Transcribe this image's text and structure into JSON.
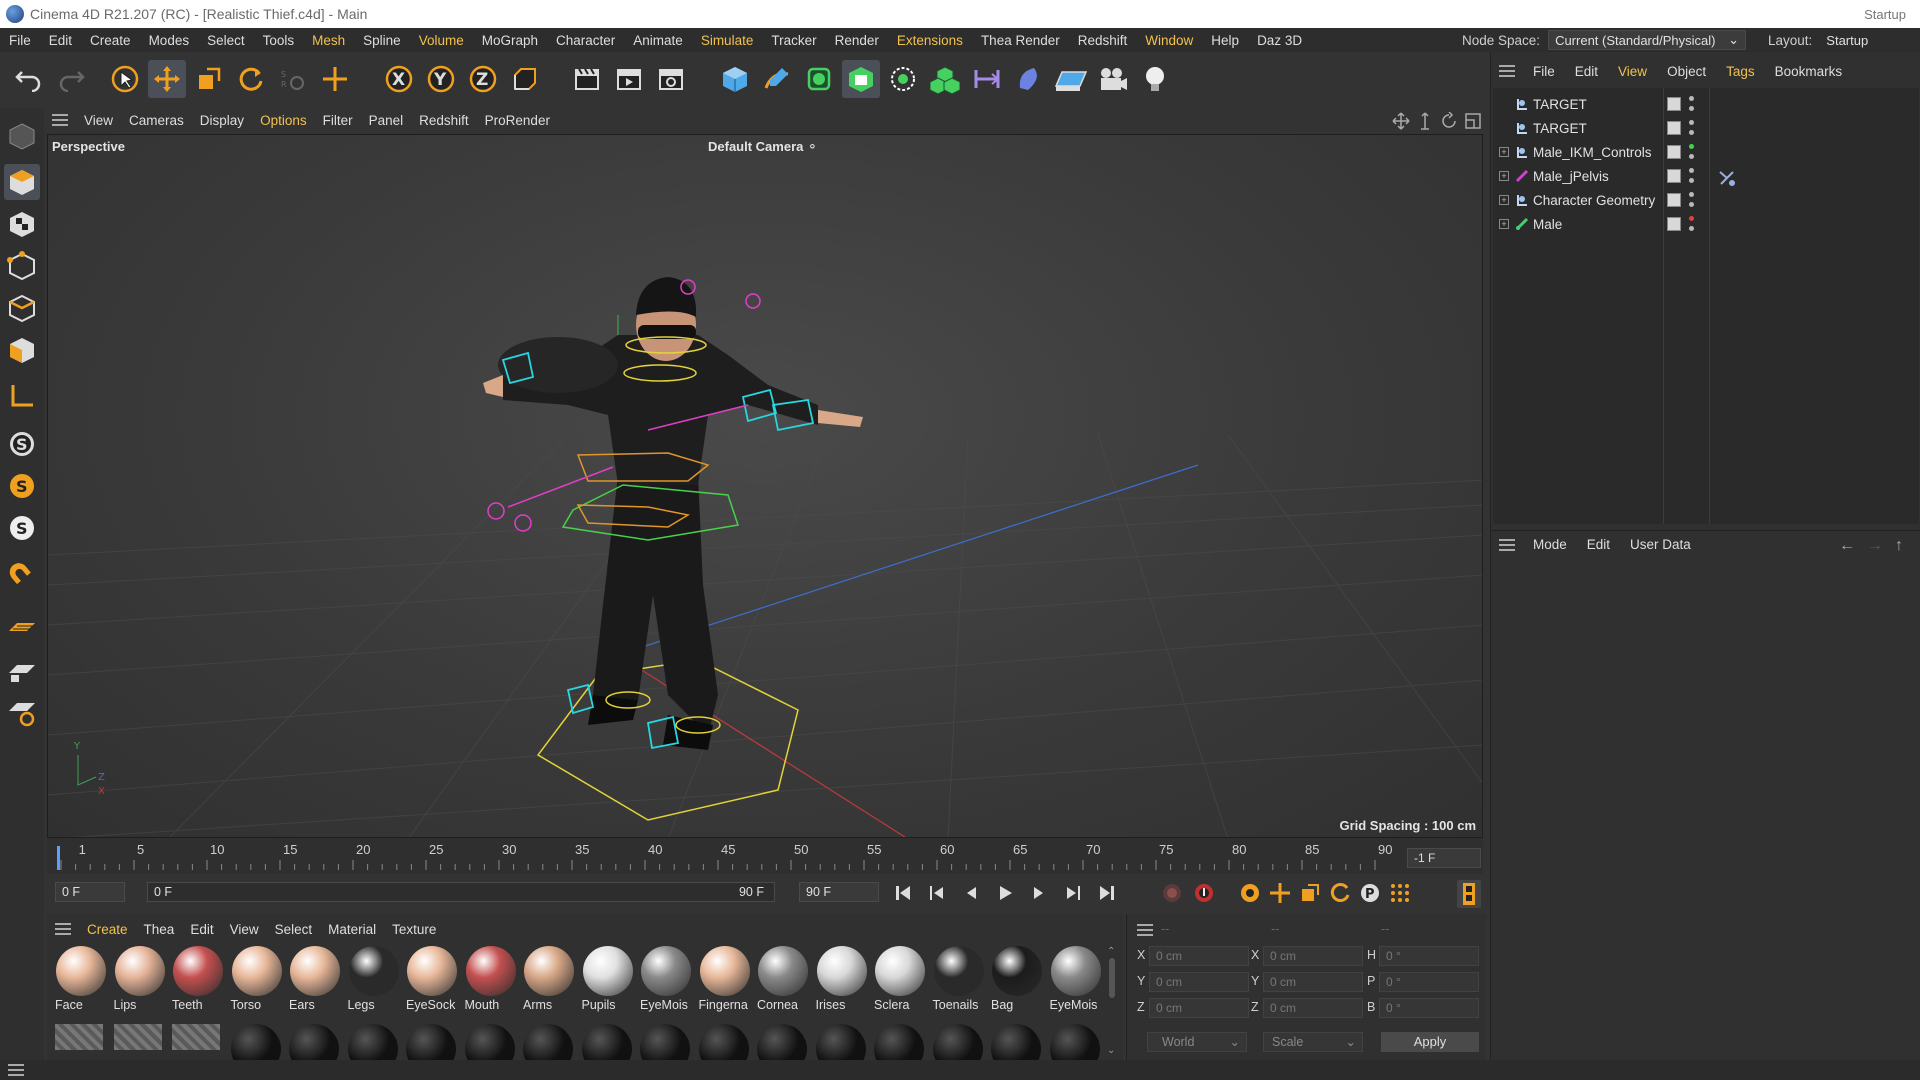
{
  "title": "Cinema 4D R21.207 (RC) - [Realistic Thief.c4d] - Main",
  "title_right": "Startup",
  "menu": [
    "File",
    "Edit",
    "Create",
    "Modes",
    "Select",
    "Tools",
    "Mesh",
    "Spline",
    "Volume",
    "MoGraph",
    "Character",
    "Animate",
    "Simulate",
    "Tracker",
    "Render",
    "Extensions",
    "Thea Render",
    "Redshift",
    "Window",
    "Help",
    "Daz 3D"
  ],
  "menu_highlight": [
    "Mesh",
    "Volume",
    "Simulate",
    "Extensions",
    "Window"
  ],
  "node_space_label": "Node Space:",
  "node_space_value": "Current (Standard/Physical)",
  "layout_label": "Layout:",
  "layout_value": "Startup",
  "viewport_menu": [
    "View",
    "Cameras",
    "Display",
    "Options",
    "Filter",
    "Panel",
    "Redshift",
    "ProRender"
  ],
  "viewport_menu_highlight": [
    "Options"
  ],
  "viewport": {
    "projection": "Perspective",
    "camera": "Default Camera",
    "grid_spacing": "Grid Spacing : 100 cm"
  },
  "object_manager_menu": [
    "File",
    "Edit",
    "View",
    "Object",
    "Tags",
    "Bookmarks"
  ],
  "object_manager_menu_highlight": [
    "View",
    "Tags"
  ],
  "objects": [
    {
      "name": "TARGET",
      "expandable": false,
      "icon": "null-icon",
      "dot": "#b8b8b8"
    },
    {
      "name": "TARGET",
      "expandable": false,
      "icon": "null-icon",
      "dot": "#b8b8b8"
    },
    {
      "name": "Male_IKM_Controls",
      "expandable": true,
      "icon": "null-icon",
      "dot": "#3fd34a"
    },
    {
      "name": "Male_jPelvis",
      "expandable": true,
      "icon": "joint-icon",
      "dot": "#b8b8b8"
    },
    {
      "name": "Character Geometry",
      "expandable": true,
      "icon": "null-icon",
      "dot": "#b8b8b8"
    },
    {
      "name": "Male",
      "expandable": true,
      "icon": "bone-icon",
      "dot": "#e04040"
    }
  ],
  "attribute_menu": [
    "Mode",
    "Edit",
    "User Data"
  ],
  "timeline": {
    "ticks": [
      "1",
      "5",
      "10",
      "15",
      "20",
      "25",
      "30",
      "35",
      "40",
      "45",
      "50",
      "55",
      "60",
      "65",
      "70",
      "75",
      "80",
      "85",
      "90"
    ],
    "end_field": "-1 F",
    "current_frame": "0 F",
    "range_start": "0 F",
    "range_end": "90 F",
    "max_frame": "90 F"
  },
  "material_menu": [
    "Create",
    "Thea",
    "Edit",
    "View",
    "Select",
    "Material",
    "Texture"
  ],
  "material_menu_highlight": [
    "Create"
  ],
  "materials": [
    {
      "name": "Face",
      "color": "#e8b89a"
    },
    {
      "name": "Lips",
      "color": "#e6b49a"
    },
    {
      "name": "Teeth",
      "color": "#c45050"
    },
    {
      "name": "Torso",
      "color": "#e8b89a"
    },
    {
      "name": "Ears",
      "color": "#e8b89a"
    },
    {
      "name": "Legs",
      "color": "#2a2a2a"
    },
    {
      "name": "EyeSock",
      "color": "#e8b89a"
    },
    {
      "name": "Mouth",
      "color": "#c45050"
    },
    {
      "name": "Arms",
      "color": "#d8a888"
    },
    {
      "name": "Pupils",
      "color": "#e0e0e0"
    },
    {
      "name": "EyeMois",
      "color": "#8a8a8a"
    },
    {
      "name": "Fingerna",
      "color": "#e8b89a"
    },
    {
      "name": "Cornea",
      "color": "#8a8a8a"
    },
    {
      "name": "Irises",
      "color": "#d8d8d8"
    },
    {
      "name": "Sclera",
      "color": "#d8d8d8"
    },
    {
      "name": "Toenails",
      "color": "#2a2a2a"
    },
    {
      "name": "Bag",
      "color": "#1c1c1c"
    },
    {
      "name": "EyeMois",
      "color": "#8a8a8a"
    }
  ],
  "coords": {
    "header_left": "--",
    "header_mid": "--",
    "header_right": "--",
    "rows": [
      {
        "a": "X",
        "av": "0 cm",
        "b": "X",
        "bv": "0 cm",
        "c": "H",
        "cv": "0 °"
      },
      {
        "a": "Y",
        "av": "0 cm",
        "b": "Y",
        "bv": "0 cm",
        "c": "P",
        "cv": "0 °"
      },
      {
        "a": "Z",
        "av": "0 cm",
        "b": "Z",
        "bv": "0 cm",
        "c": "B",
        "cv": "0 °"
      }
    ],
    "world": "World",
    "scale": "Scale",
    "apply": "Apply"
  },
  "colors": {
    "accent": "#f2c14e",
    "spline_yellow": "#e3d23a",
    "spline_green": "#49d04a",
    "spline_cyan": "#28d6e0",
    "spline_magenta": "#e03ec8",
    "spline_orange": "#e0962a"
  }
}
